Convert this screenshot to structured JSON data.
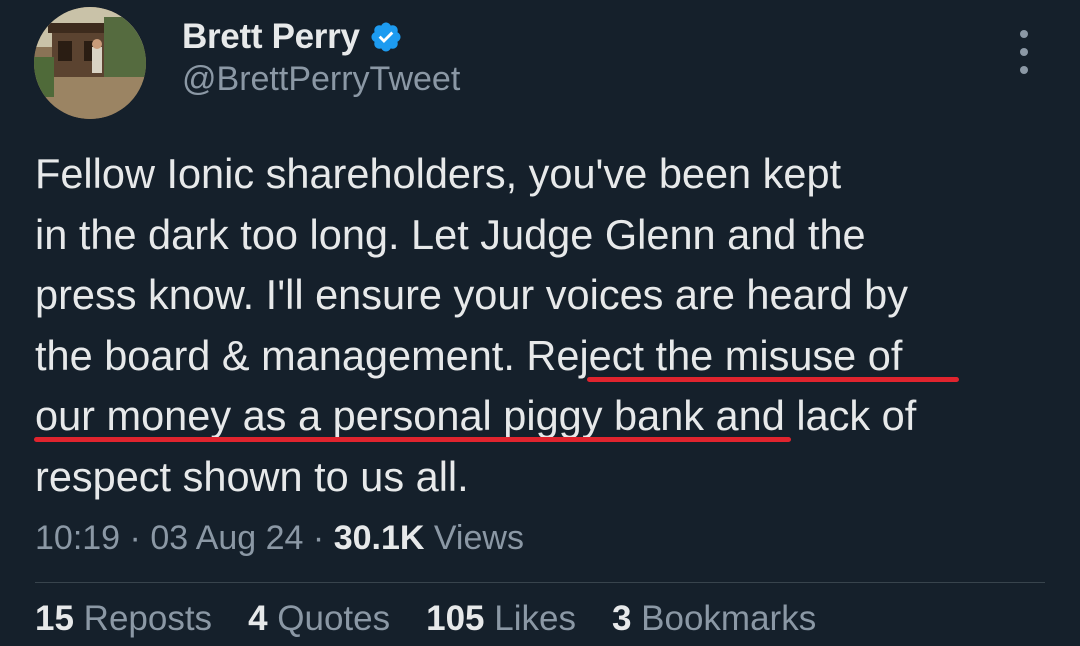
{
  "author": {
    "display_name": "Brett Perry",
    "handle": "@BrettPerryTweet",
    "verified": true,
    "verified_color": "#1d9bf0",
    "avatar": "avatar-photo"
  },
  "tweet": {
    "lines": [
      "Fellow Ionic shareholders, you've been kept",
      "in the dark too long. Let Judge Glenn and the",
      "press know. I'll ensure your voices are heard by",
      "the board & management. Reject the misuse of",
      "our money as a personal piggy bank and lack of",
      "respect shown to us all."
    ],
    "highlight_color": "#e0242e",
    "highlighted_phrase": "Reject the misuse of our money as a personal piggy bank"
  },
  "meta": {
    "time": "10:19",
    "separator": " · ",
    "date": "03 Aug 24",
    "views_count": "30.1K",
    "views_label": " Views"
  },
  "stats": [
    {
      "count": "15",
      "label": " Reposts"
    },
    {
      "count": "4",
      "label": " Quotes"
    },
    {
      "count": "105",
      "label": " Likes"
    },
    {
      "count": "3",
      "label": " Bookmarks"
    }
  ],
  "icons": {
    "more": "more-vertical-icon",
    "verified": "verified-badge-icon"
  },
  "colors": {
    "background": "#15202b",
    "text": "#e7e9ea",
    "secondary": "#8b98a5",
    "divider": "#38444d"
  }
}
